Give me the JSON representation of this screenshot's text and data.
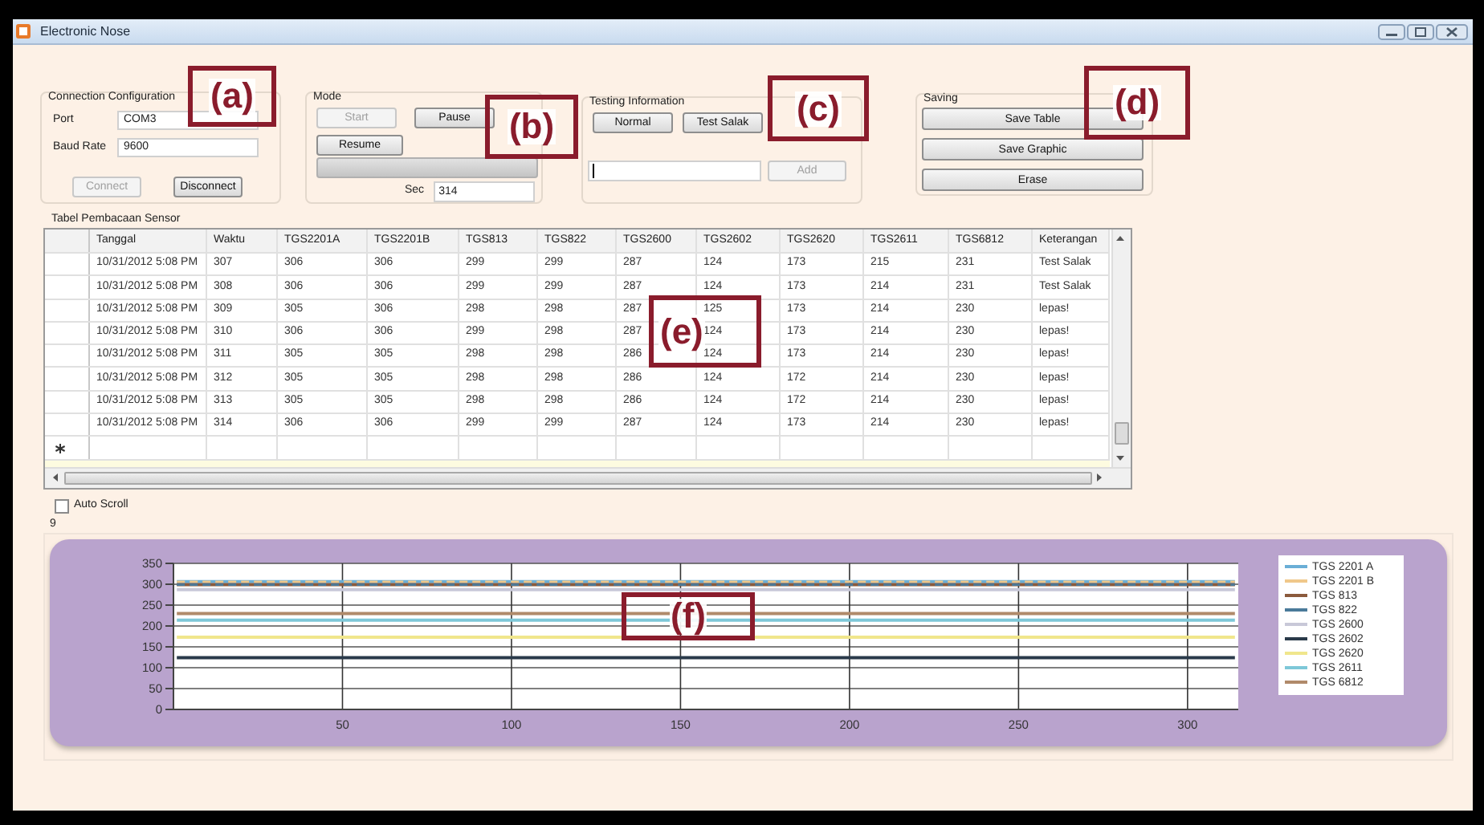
{
  "window": {
    "title": "Electronic Nose"
  },
  "connection": {
    "title": "Connection Configuration",
    "fields": [
      {
        "label": "Port",
        "value": "COM3"
      },
      {
        "label": "Baud Rate",
        "value": "9600"
      }
    ],
    "buttons": [
      {
        "label": "Connect",
        "disabled": true
      },
      {
        "label": "Disconnect",
        "disabled": false
      }
    ]
  },
  "mode": {
    "title": "Mode",
    "buttons": [
      {
        "label": "Start",
        "disabled": true
      },
      {
        "label": "Pause",
        "disabled": false
      },
      {
        "label": "Resume",
        "disabled": false
      }
    ],
    "progress": {
      "level": 0
    },
    "sec_label": "Sec",
    "sec_value": "314"
  },
  "testing": {
    "title": "Testing Information",
    "buttons": [
      {
        "label": "Normal",
        "disabled": false
      },
      {
        "label": "Test Salak",
        "disabled": false
      }
    ],
    "add_button": {
      "label": "Add",
      "disabled": true
    }
  },
  "saving": {
    "title": "Saving",
    "buttons": [
      {
        "label": "Save Table"
      },
      {
        "label": "Save Graphic"
      },
      {
        "label": "Erase"
      }
    ]
  },
  "table": {
    "title": "Tabel Pembacaan Sensor",
    "columns": [
      "Tanggal",
      "Waktu",
      "TGS2201A",
      "TGS2201B",
      "TGS813",
      "TGS822",
      "TGS2600",
      "TGS2602",
      "TGS2620",
      "TGS2611",
      "TGS6812",
      "Keterangan"
    ],
    "rows": [
      [
        "10/31/2012 5:08 PM",
        "307",
        "306",
        "306",
        "299",
        "299",
        "287",
        "124",
        "173",
        "215",
        "231",
        "Test Salak"
      ],
      [
        "10/31/2012 5:08 PM",
        "308",
        "306",
        "306",
        "299",
        "299",
        "287",
        "124",
        "173",
        "214",
        "231",
        "Test Salak"
      ],
      [
        "10/31/2012 5:08 PM",
        "309",
        "305",
        "306",
        "298",
        "298",
        "287",
        "125",
        "173",
        "214",
        "230",
        "lepas!"
      ],
      [
        "10/31/2012 5:08 PM",
        "310",
        "306",
        "306",
        "299",
        "298",
        "287",
        "124",
        "173",
        "214",
        "230",
        "lepas!"
      ],
      [
        "10/31/2012 5:08 PM",
        "311",
        "305",
        "305",
        "298",
        "298",
        "286",
        "124",
        "173",
        "214",
        "230",
        "lepas!"
      ],
      [
        "10/31/2012 5:08 PM",
        "312",
        "305",
        "305",
        "298",
        "298",
        "286",
        "124",
        "172",
        "214",
        "230",
        "lepas!"
      ],
      [
        "10/31/2012 5:08 PM",
        "313",
        "305",
        "305",
        "298",
        "298",
        "286",
        "124",
        "172",
        "214",
        "230",
        "lepas!"
      ],
      [
        "10/31/2012 5:08 PM",
        "314",
        "306",
        "306",
        "299",
        "299",
        "287",
        "124",
        "173",
        "214",
        "230",
        "lepas!"
      ]
    ]
  },
  "auto_scroll": {
    "label": "Auto Scroll",
    "checked": false
  },
  "counter": "9",
  "chart": {
    "chart_data": {
      "type": "line",
      "grid": true,
      "legend": true,
      "x": [
        1,
        314
      ],
      "xlim": [
        0,
        315
      ],
      "ylim": [
        0,
        350
      ],
      "xticks": [
        50,
        100,
        150,
        200,
        250,
        300
      ],
      "yticks": [
        0,
        50,
        100,
        150,
        200,
        250,
        300,
        350
      ],
      "series": [
        {
          "name": "TGS 2201 A",
          "color": "#6aaed6",
          "values": [
            306,
            306
          ]
        },
        {
          "name": "TGS 2201 B",
          "color": "#f0c88a",
          "line_style": "dashed",
          "values": [
            306,
            306
          ]
        },
        {
          "name": "TGS 813",
          "color": "#8b5a3c",
          "values": [
            299,
            299
          ]
        },
        {
          "name": "TGS 822",
          "color": "#4a7a9a",
          "line_style": "dashed",
          "values": [
            299,
            299
          ]
        },
        {
          "name": "TGS 2600",
          "color": "#c8c8d8",
          "values": [
            287,
            287
          ]
        },
        {
          "name": "TGS 2602",
          "color": "#2a3a4a",
          "values": [
            124,
            124
          ]
        },
        {
          "name": "TGS 2620",
          "color": "#f0e68c",
          "values": [
            173,
            173
          ]
        },
        {
          "name": "TGS 2611",
          "color": "#7ec8d8",
          "values": [
            214,
            214
          ]
        },
        {
          "name": "TGS 6812",
          "color": "#b08a6a",
          "values": [
            230,
            230
          ]
        }
      ]
    }
  },
  "annotations": [
    {
      "label": "(a)"
    },
    {
      "label": "(b)"
    },
    {
      "label": "(c)"
    },
    {
      "label": "(d)"
    },
    {
      "label": "(e)"
    },
    {
      "label": "(f)"
    }
  ]
}
